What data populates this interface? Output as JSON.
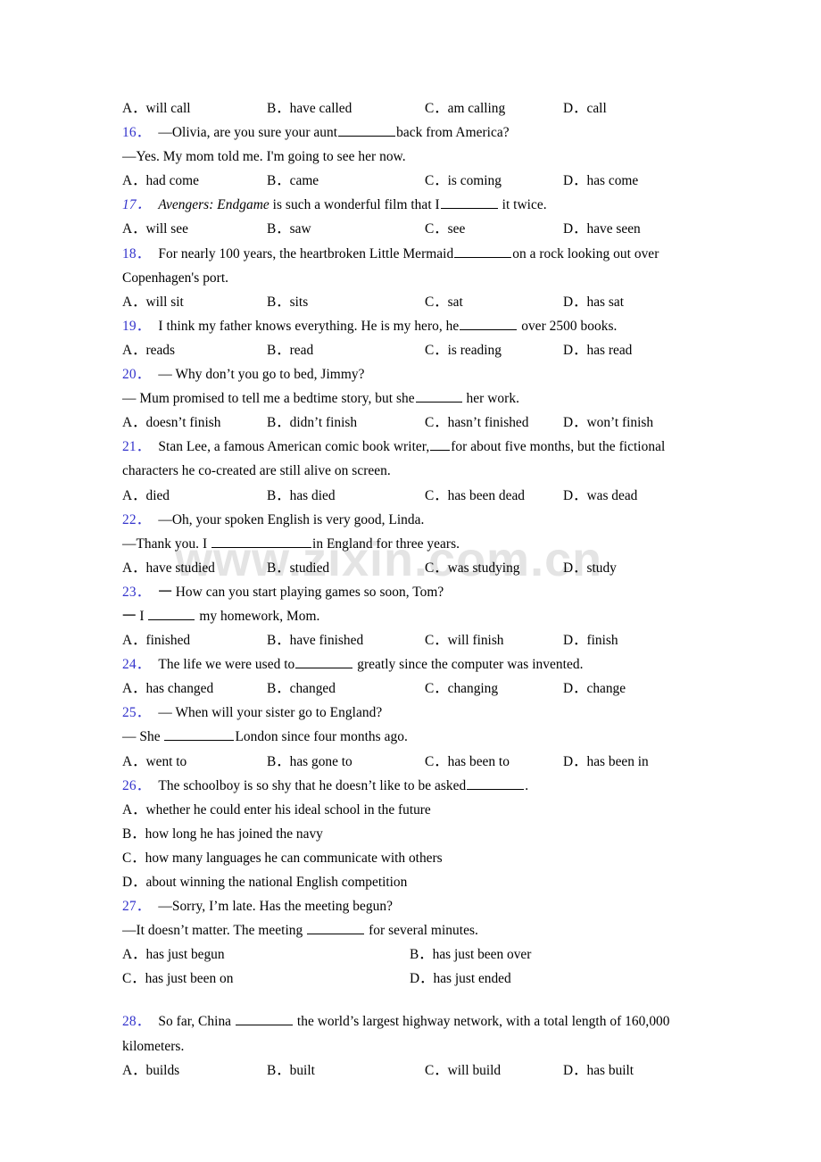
{
  "document": {
    "type": "english-grammar-worksheet",
    "watermark": "www.zixin.com.cn",
    "number_color": "#3333cc",
    "text_color": "#000000",
    "background": "#ffffff"
  },
  "top_orphan_options": {
    "a": "A．will call",
    "b": "B．have called",
    "c": "C．am calling",
    "d": "D．call"
  },
  "questions": [
    {
      "num": "16．",
      "stem": "—Olivia, are you sure your aunt ________back from America?",
      "stem_pre": "—Olivia, are you sure your aunt",
      "stem_post": "back from America?",
      "stem2": "—Yes. My mom told me. I'm going to see her now.",
      "options": [
        "A．had come",
        "B．came",
        "C．is coming",
        "D．has come"
      ]
    },
    {
      "num": "17．",
      "italic_num": true,
      "stem_italic": "Avengers: Endgame",
      "stem_pre": "",
      "stem_mid": " is such a wonderful film that I",
      "stem_post": " it twice.",
      "options": [
        "A．will see",
        "B．saw",
        "C．see",
        "D．have seen"
      ]
    },
    {
      "num": "18．",
      "stem_pre": "For nearly 100 years, the heartbroken Little Mermaid",
      "stem_post": "on a rock looking out over Copenhagen's port.",
      "options": [
        "A．will sit",
        "B．sits",
        "C．sat",
        "D．has sat"
      ]
    },
    {
      "num": "19．",
      "stem_pre": "I think my father knows everything. He is my hero, he",
      "stem_post": " over 2500 books.",
      "options": [
        "A．reads",
        "B．read",
        "C．is reading",
        "D．has read"
      ]
    },
    {
      "num": "20．",
      "stem_pre": "— Why don’t you go to bed, Jimmy?",
      "stem2_pre": "— Mum promised to tell me a bedtime story, but she",
      "stem2_post": " her work.",
      "options": [
        "A．doesn’t finish",
        "B．didn’t finish",
        "C．hasn’t finished",
        "D．won’t finish"
      ]
    },
    {
      "num": "21．",
      "stem_pre": "Stan Lee, a famous American comic book writer,",
      "stem_post": "for about five months, but the fictional characters he co-created are still alive on screen.",
      "options": [
        "A．died",
        "B．has died",
        "C．has been dead",
        "D．was dead"
      ]
    },
    {
      "num": "22．",
      "stem_pre": "—Oh, your spoken English is very good, Linda.",
      "stem2_pre": "—Thank you. I ",
      "stem2_post": "in England for three years.",
      "options": [
        "A．have studied",
        "B．studied",
        "C．was studying",
        "D．study"
      ]
    },
    {
      "num": "23．",
      "stem_pre": "一 How can you start playing games so soon, Tom?",
      "stem2_pre": "一 I ",
      "stem2_post": " my homework, Mom.",
      "options": [
        "A．finished",
        "B．have finished",
        "C．will finish",
        "D．finish"
      ]
    },
    {
      "num": "24．",
      "stem_pre": "The life we were used to",
      "stem_post": " greatly since the computer was invented.",
      "options": [
        "A．has changed",
        "B．changed",
        "C．changing",
        "D．change"
      ]
    },
    {
      "num": "25．",
      "stem_pre": "— When will your sister go to England?",
      "stem2_pre": "— She ",
      "stem2_post": "London since four months ago.",
      "options": [
        "A．went to",
        "B．has gone to",
        "C．has been to",
        "D．has been in"
      ]
    },
    {
      "num": "26．",
      "stem_pre": "The schoolboy is so shy that he doesn’t like to be asked",
      "stem_post": ".",
      "options_stacked": [
        "A．whether he could enter his ideal school in the future",
        "B．how long he has joined the navy",
        "C．how many languages he can communicate with others",
        "D．about winning the national English competition"
      ]
    },
    {
      "num": "27．",
      "stem_pre": "—Sorry, I’m late. Has the meeting begun?",
      "stem2_pre": "—It doesn’t matter. The meeting ",
      "stem2_post": " for several minutes.",
      "options_two_col": [
        [
          "A．has just begun",
          "B．has just been over"
        ],
        [
          "C．has just been on",
          "D．has just ended"
        ]
      ]
    },
    {
      "num": "28．",
      "stem_pre": "So far, China ",
      "stem_post": " the world’s largest highway network, with a total length of 160,000 kilometers.",
      "options": [
        "A．builds",
        "B．built",
        "C．will build",
        "D．has built"
      ]
    }
  ]
}
